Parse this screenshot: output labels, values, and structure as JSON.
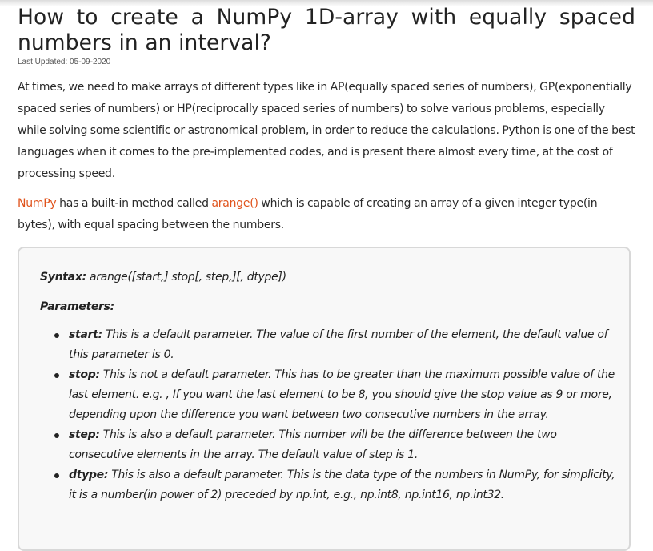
{
  "article": {
    "title": "How to create a NumPy 1D-array with equally spaced numbers in an interval?",
    "last_updated": "Last Updated: 05-09-2020",
    "intro": "At times, we need to make arrays of different types like in AP(equally spaced series of numbers), GP(exponentially spaced series of numbers) or HP(reciprocally spaced series of numbers) to solve various problems, especially while solving some scientific or astronomical problem, in order to reduce the calculations. Python is one of the best languages when it comes to the pre-implemented codes, and is present there almost every time, at the cost of processing speed.",
    "para2": {
      "link_numpy": "NumPy",
      "text_a": " has a built-in method called ",
      "link_arange": "arange()",
      "text_b": " which is capable of creating an array of a given integer type(in bytes), with equal spacing between the numbers."
    }
  },
  "syntax_box": {
    "syntax_label": "Syntax:",
    "syntax_value": " arange([start,] stop[, step,][, dtype])",
    "parameters_label": "Parameters:",
    "params": [
      {
        "name": "start:",
        "desc": " This is a default parameter. The value of the first number of the element, the default value of this parameter is 0."
      },
      {
        "name": "stop:",
        "desc": " This is not a default parameter. This has to be greater than the maximum possible value of the last element. e.g. , If you want the last element to be 8, you should give the stop value as 9 or more, depending upon the difference you want between two consecutive numbers in the array."
      },
      {
        "name": "step:",
        "desc": " This is also a default parameter. This number will be the difference between the two consecutive elements in the array. The default value of step is 1."
      },
      {
        "name": "dtype:",
        "desc": " This is also a default parameter. This is the data type of the numbers in NumPy, for simplicity, it is a number(in power of 2) preceded by np.int, e.g., np.int8, np.int16, np.int32."
      }
    ]
  },
  "colors": {
    "link": "#e0531c",
    "box_background": "#f8f8f8",
    "box_border": "#d8d8d8"
  }
}
